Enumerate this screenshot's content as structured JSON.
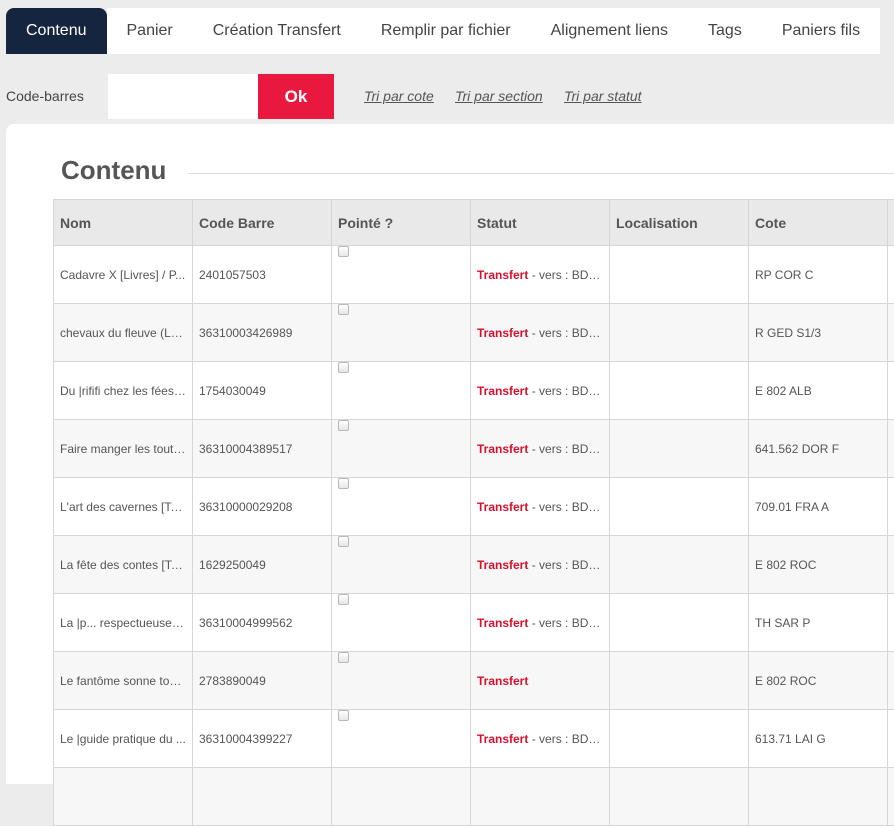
{
  "tabs": [
    {
      "label": "Contenu",
      "active": true
    },
    {
      "label": "Panier",
      "active": false
    },
    {
      "label": "Création Transfert",
      "active": false
    },
    {
      "label": "Remplir par fichier",
      "active": false
    },
    {
      "label": "Alignement liens",
      "active": false
    },
    {
      "label": "Tags",
      "active": false
    },
    {
      "label": "Paniers fils",
      "active": false
    }
  ],
  "barcode": {
    "label": "Code-barres",
    "value": "",
    "ok_label": "Ok"
  },
  "sort_links": [
    "Tri par cote",
    "Tri par section",
    "Tri par statut"
  ],
  "section_title": "Contenu",
  "table": {
    "headers": [
      "Nom",
      "Code Barre",
      "Pointé ?",
      "Statut",
      "Localisation",
      "Cote"
    ],
    "rows": [
      {
        "nom": "Cadavre X [Livres] / P...",
        "code_barre": "2401057503",
        "statut": "Transfert",
        "statut_detail": " - vers : BDP-...",
        "localisation": "",
        "cote": "RP COR C"
      },
      {
        "nom": "chevaux du fleuve (Le...",
        "code_barre": "36310003426989",
        "statut": "Transfert",
        "statut_detail": " - vers : BDP-...",
        "localisation": "",
        "cote": "R GED S1/3"
      },
      {
        "nom": "Du |rififi chez les fées [...",
        "code_barre": "1754030049",
        "statut": "Transfert",
        "statut_detail": " - vers : BDP-...",
        "localisation": "",
        "cote": "E 802 ALB"
      },
      {
        "nom": "Faire manger les tout-...",
        "code_barre": "36310004389517",
        "statut": "Transfert",
        "statut_detail": " - vers : BDP-...",
        "localisation": "",
        "cote": "641.562 DOR F"
      },
      {
        "nom": "L'art des cavernes [Te...",
        "code_barre": "36310000029208",
        "statut": "Transfert",
        "statut_detail": " - vers : BDP-...",
        "localisation": "",
        "cote": "709.01 FRA A"
      },
      {
        "nom": "La fête des contes [Te...",
        "code_barre": "1629250049",
        "statut": "Transfert",
        "statut_detail": " - vers : BDP-...",
        "localisation": "",
        "cote": "E 802 ROC"
      },
      {
        "nom": "La |p... respectueuse [...",
        "code_barre": "36310004999562",
        "statut": "Transfert",
        "statut_detail": " - vers : BDP-...",
        "localisation": "",
        "cote": "TH SAR P"
      },
      {
        "nom": "Le fantôme sonne tou...",
        "code_barre": "2783890049",
        "statut": "Transfert",
        "statut_detail": "",
        "localisation": "",
        "cote": "E 802 ROC"
      },
      {
        "nom": "Le |guide pratique du ...",
        "code_barre": "36310004399227",
        "statut": "Transfert",
        "statut_detail": " - vers : BDP-...",
        "localisation": "",
        "cote": "613.71 LAI G"
      },
      {
        "nom": "",
        "code_barre": "",
        "statut": "",
        "statut_detail": "",
        "localisation": "",
        "cote": ""
      }
    ]
  }
}
